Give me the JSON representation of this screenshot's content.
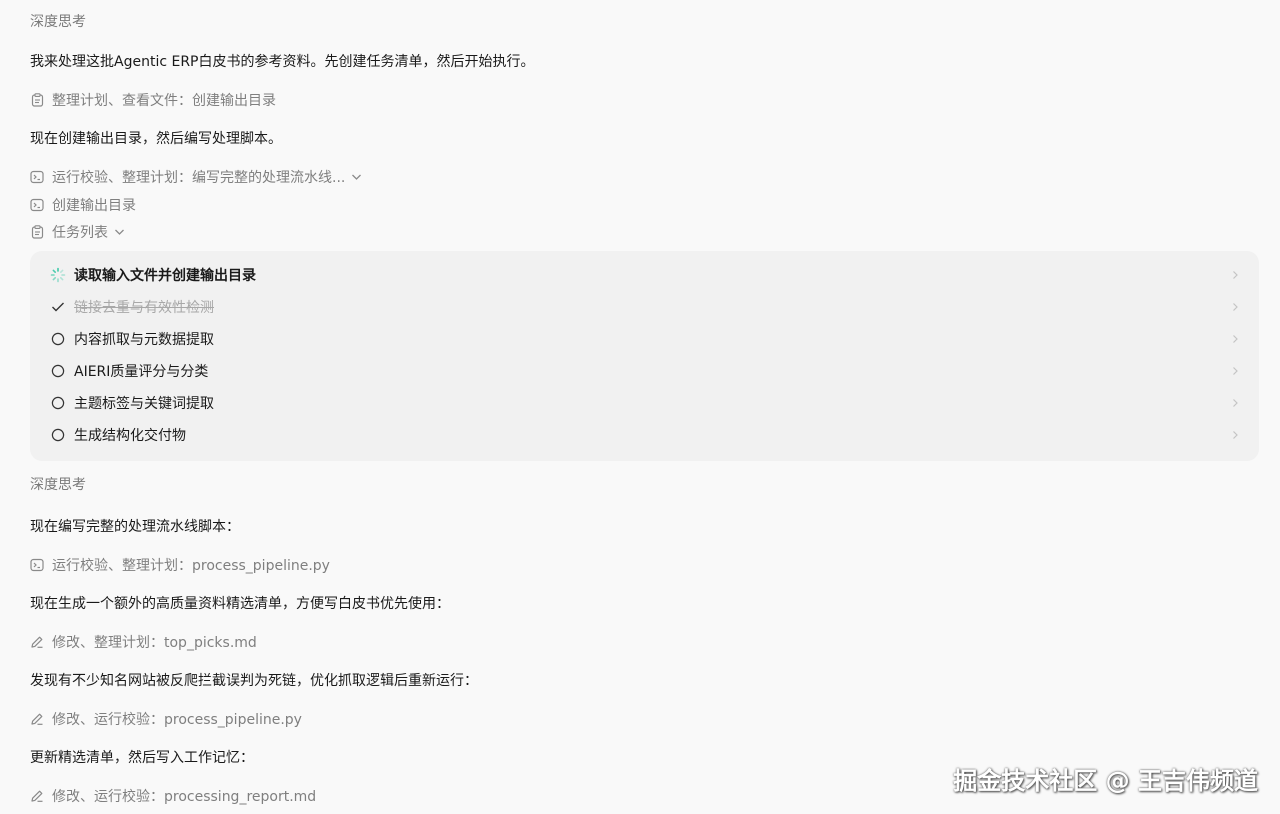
{
  "stream": {
    "think1": "深度思考",
    "msg1": "我来处理这批Agentic ERP白皮书的参考资料。先创建任务清单，然后开始执行。",
    "act1": "整理计划、查看文件：创建输出目录",
    "msg2": "现在创建输出目录，然后编写处理脚本。",
    "act2": "运行校验、整理计划：编写完整的处理流水线...",
    "act3": "创建输出目录",
    "act4": "任务列表",
    "tasks": [
      {
        "label": "读取输入文件并创建输出目录",
        "state": "in-progress"
      },
      {
        "label": "链接去重与有效性检测",
        "state": "done"
      },
      {
        "label": "内容抓取与元数据提取",
        "state": "pending"
      },
      {
        "label": "AIERI质量评分与分类",
        "state": "pending"
      },
      {
        "label": "主题标签与关键词提取",
        "state": "pending"
      },
      {
        "label": "生成结构化交付物",
        "state": "pending"
      }
    ],
    "think2": "深度思考",
    "msg3": "现在编写完整的处理流水线脚本：",
    "act5": "运行校验、整理计划：process_pipeline.py",
    "msg4": "现在生成一个额外的高质量资料精选清单，方便写白皮书优先使用：",
    "act6": "修改、整理计划：top_picks.md",
    "msg5": "发现有不少知名网站被反爬拦截误判为死链，优化抓取逻辑后重新运行：",
    "act7": "修改、运行校验：process_pipeline.py",
    "msg6": "更新精选清单，然后写入工作记忆：",
    "act8": "修改、运行校验：processing_report.md"
  },
  "icons": {
    "clipboard": "clipboard-icon",
    "terminal": "terminal-icon",
    "pencil": "pencil-icon",
    "chevron": "chevron-down-icon",
    "spinner": "spinner-icon",
    "check": "check-icon",
    "circle": "circle-icon",
    "chevron_right": "chevron-right-icon"
  },
  "colors": {
    "spinner": "#3cc9a8",
    "muted": "#7f7f7f",
    "panel": "#f1f1f1"
  },
  "watermark": "掘金技术社区 @ 王吉伟频道"
}
